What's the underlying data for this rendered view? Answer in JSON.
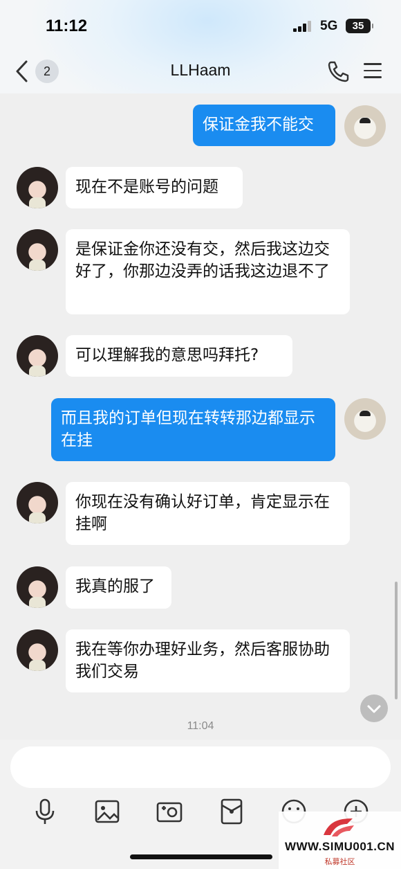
{
  "status_bar": {
    "time": "11:12",
    "network": "5G",
    "battery": "35"
  },
  "header": {
    "back_badge": "2",
    "title": "LLHaam"
  },
  "messages": [
    {
      "side": "out",
      "text": "保证金我不能交"
    },
    {
      "side": "in",
      "text": "现在不是账号的问题"
    },
    {
      "side": "in",
      "text": "是保证金你还没有交，然后我这边交好了，你那边没弄的话我这边退不了"
    },
    {
      "side": "in",
      "text": "可以理解我的意思吗拜托?"
    },
    {
      "side": "out",
      "text": "而且我的订单但现在转转那边都显示在挂"
    },
    {
      "side": "in",
      "text": "你现在没有确认好订单，肯定显示在挂啊"
    },
    {
      "side": "in",
      "text": "我真的服了"
    },
    {
      "side": "in",
      "text": "我在等你办理好业务，然后客服协助我们交易"
    }
  ],
  "timestamp": "11:04",
  "input": {
    "placeholder": ""
  },
  "toolbar": [
    "microphone-icon",
    "image-icon",
    "camera-icon",
    "red-packet-icon",
    "emoji-icon",
    "plus-icon"
  ],
  "watermark": {
    "text": "WWW.SIMU001.CN",
    "sub": "私募社区"
  },
  "colors": {
    "outgoing_bubble": "#1a8cf0",
    "incoming_bubble": "#ffffff",
    "background": "#efefef"
  }
}
